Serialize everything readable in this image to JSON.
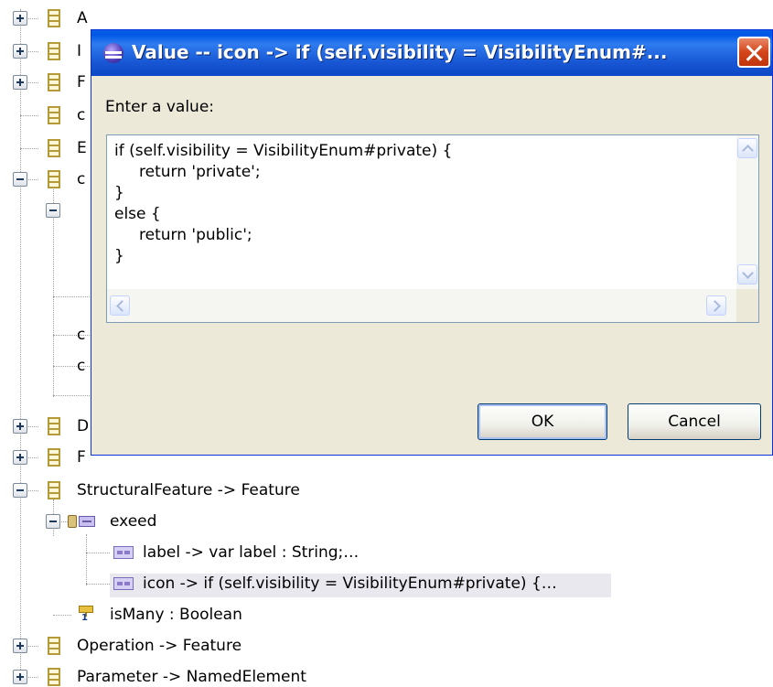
{
  "tree": {
    "rows": [
      {
        "id": "r1",
        "label": "A",
        "expander": "plus"
      },
      {
        "id": "r2",
        "label": "I",
        "expander": "plus"
      },
      {
        "id": "r3",
        "label": "F",
        "expander": "plus"
      },
      {
        "id": "r4",
        "label": "c",
        "expander": "none"
      },
      {
        "id": "r5",
        "label": "E",
        "expander": "none"
      },
      {
        "id": "r6",
        "label": "c",
        "expander": "minus"
      },
      {
        "id": "r7",
        "label": "D",
        "expander": "plus"
      },
      {
        "id": "r8",
        "label": "F",
        "expander": "plus"
      },
      {
        "id": "r9",
        "label": "StructuralFeature -> Feature",
        "expander": "minus"
      },
      {
        "id": "r10",
        "label": "exeed",
        "expander": "minus"
      },
      {
        "id": "r11",
        "label": "label -> var label : String;…"
      },
      {
        "id": "r12",
        "label": "icon -> if (self.visibility = VisibilityEnum#private) {…",
        "selected": true
      },
      {
        "id": "r13",
        "label": "isMany : Boolean",
        "multiplicity": "1"
      },
      {
        "id": "r14",
        "label": "Operation -> Feature",
        "expander": "plus"
      },
      {
        "id": "r15",
        "label": "Parameter -> NamedElement",
        "expander": "plus"
      }
    ],
    "partial_labels": [
      "c",
      "c"
    ]
  },
  "dialog": {
    "title": "Value -- icon -> if (self.visibility = VisibilityEnum#...",
    "prompt": "Enter a value:",
    "value": "if (self.visibility = VisibilityEnum#private) {\n     return 'private';\n}\nelse {\n     return 'public';\n}",
    "ok_label": "OK",
    "cancel_label": "Cancel"
  },
  "icons": {
    "title": "eclipse-icon",
    "close": "close-icon"
  }
}
